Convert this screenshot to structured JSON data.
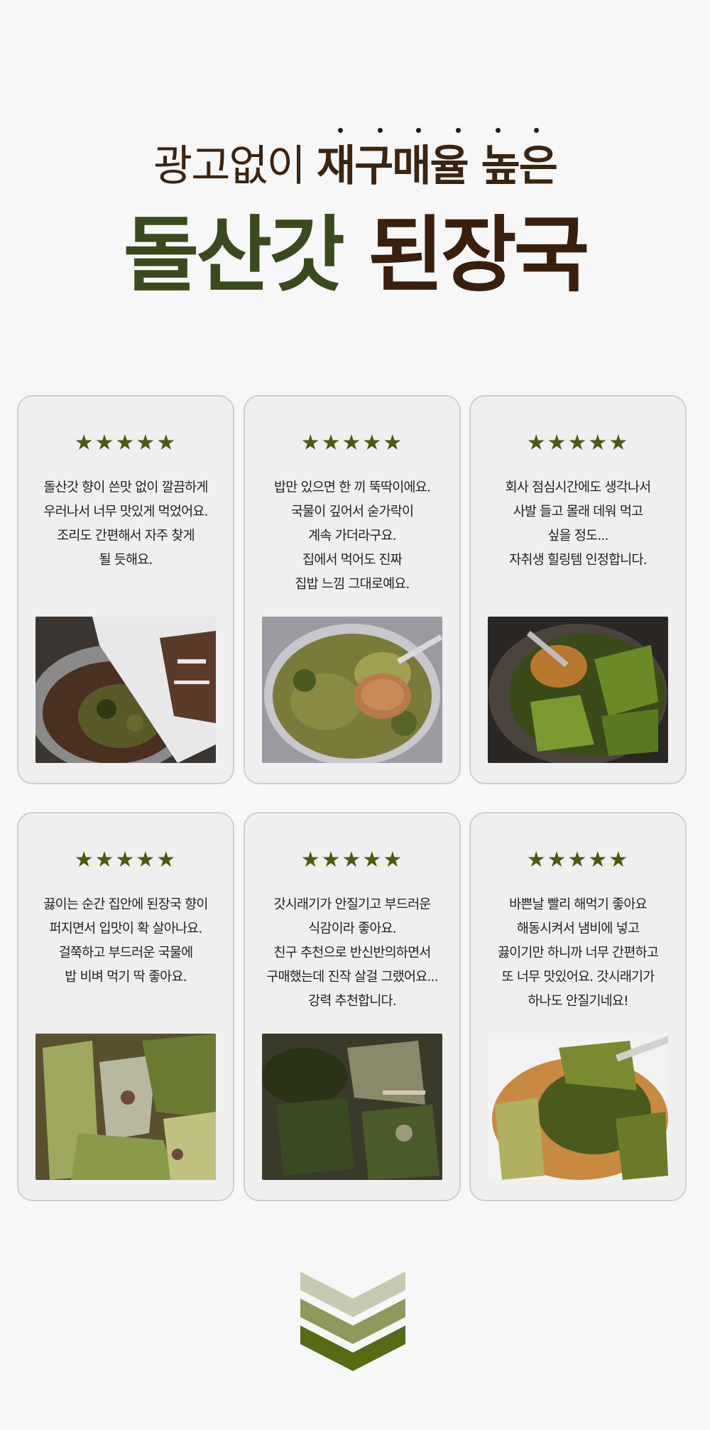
{
  "header": {
    "subtitle_light": "광고없이",
    "subtitle_bold": "재구매율 높은",
    "title_green": "돌산갓",
    "title_brown": "된장국"
  },
  "rating": "★★★★★",
  "reviews": [
    {
      "lines": [
        "돌산갓 향이 쓴맛 없이 깔끔하게",
        "우러나서 너무 맛있게 먹었어요.",
        "조리도 간편해서 자주 찾게",
        "될 듯해요."
      ],
      "photo_icon": "soup-pouring-photo"
    },
    {
      "lines": [
        "밥만 있으면 한 끼 뚝딱이에요.",
        "국물이 깊어서 숟가락이",
        "계속 가더라구요.",
        "집에서 먹어도 진짜",
        "집밥 느낌 그대로예요."
      ],
      "photo_icon": "ladle-soup-photo"
    },
    {
      "lines": [
        "회사 점심시간에도 생각나서",
        "사발 들고 몰래 데워 먹고",
        "싶을 정도...",
        "자취생 힐링템 인정합니다."
      ],
      "photo_icon": "ladle-greens-photo"
    },
    {
      "lines": [
        "끓이는 순간 집안에 된장국 향이",
        "퍼지면서 입맛이 확 살아나요.",
        "걸쭉하고 부드러운 국물에",
        "밥 비벼 먹기 딱 좋아요."
      ],
      "photo_icon": "greens-closeup-photo"
    },
    {
      "lines": [
        "갓시래기가 안질기고 부드러운",
        "식감이라 좋아요.",
        "친구 추천으로 반신반의하면서",
        "구매했는데 진작 살걸 그랬어요...",
        "강력 추천합니다."
      ],
      "photo_icon": "dark-greens-photo"
    },
    {
      "lines": [
        "바쁜날 빨리 해먹기 좋아요",
        "해동시켜서 냄비에 넣고",
        "끓이기만 하니까 너무 간편하고",
        "또 너무 맛있어요. 갓시래기가",
        "하나도 안질기네요!"
      ],
      "photo_icon": "spoon-greens-photo"
    }
  ],
  "colors": {
    "accent_green": "#4a5a12",
    "title_green": "#3a4a1c",
    "title_brown": "#3a1f0d",
    "chevron_light": "#c6cab0",
    "chevron_mid": "#8e9a5c",
    "chevron_dark": "#566b14"
  },
  "footer": {
    "icon": "chevrons-down-icon"
  }
}
